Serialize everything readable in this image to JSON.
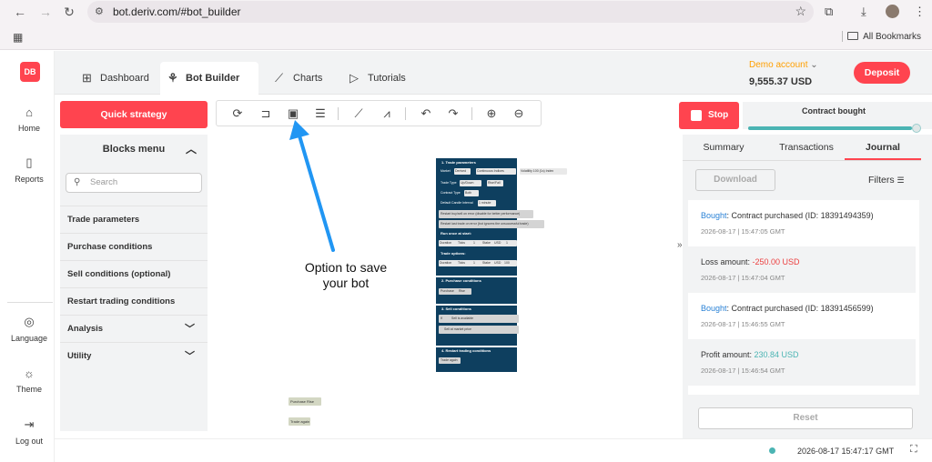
{
  "browser": {
    "url": "bot.deriv.com/#bot_builder",
    "bookmarks_label": "All Bookmarks"
  },
  "sidebar": {
    "logo": "DB",
    "items": [
      {
        "label": "Home",
        "icon": "home-icon"
      },
      {
        "label": "Reports",
        "icon": "report-icon"
      },
      {
        "label": "Language",
        "icon": "globe-icon"
      },
      {
        "label": "Theme",
        "icon": "sun-icon"
      },
      {
        "label": "Log out",
        "icon": "logout-icon"
      }
    ]
  },
  "header": {
    "tabs": [
      {
        "label": "Dashboard",
        "icon": "grid-icon"
      },
      {
        "label": "Bot Builder",
        "icon": "bot-icon",
        "active": true
      },
      {
        "label": "Charts",
        "icon": "chart-icon"
      },
      {
        "label": "Tutorials",
        "icon": "tutorial-icon"
      }
    ],
    "account_label": "Demo account",
    "balance": "9,555.37 USD",
    "deposit_label": "Deposit"
  },
  "builder": {
    "quick_strategy_label": "Quick strategy",
    "blocks_menu_title": "Blocks menu",
    "search_placeholder": "Search",
    "block_items": [
      {
        "label": "Trade parameters"
      },
      {
        "label": "Purchase conditions"
      },
      {
        "label": "Sell conditions (optional)"
      },
      {
        "label": "Restart trading conditions"
      },
      {
        "label": "Analysis",
        "expandable": true
      },
      {
        "label": "Utility",
        "expandable": true
      }
    ],
    "workspace": {
      "block_titles": [
        "1. Trade parameters",
        "2. Purchase conditions",
        "3. Sell conditions",
        "4. Restart trading conditions"
      ],
      "trade_params": {
        "market_label": "Market",
        "market_values": [
          "Derived",
          "Continuous Indices",
          "Volatility 100 (1s) Index"
        ],
        "trade_type_label": "Trade Type",
        "trade_type_values": [
          "Up/Down",
          "Rise/Fall"
        ],
        "contract_type_label": "Contract Type",
        "contract_type_value": "Both",
        "candle_label": "Default Candle Interval",
        "candle_value": "1 minute",
        "restart_error_label": "Restart buy/sell on error (disable for better performance)",
        "restart_last_label": "Restart last trade on error (bot ignores the unsuccessful trade)",
        "run_once_title": "Run once at start:",
        "run_once_row": [
          "Duration",
          "Ticks",
          "1",
          "Stake",
          "USD",
          "1"
        ],
        "trade_options_title": "Trade options:",
        "trade_options_row": [
          "Duration",
          "Ticks",
          "1",
          "Stake",
          "USD",
          "100"
        ]
      },
      "purchase_label": "Purchase",
      "purchase_value": "Rise",
      "sell_if_label": "if",
      "sell_available_label": "Sell is available",
      "sell_then_label": "Sell at market price",
      "restart_label": "Trade again",
      "loose_purchase_label": "Purchase",
      "loose_purchase_value": "Rise",
      "loose_trade_again": "Trade again"
    },
    "annotation": "Option to save your bot"
  },
  "run_panel": {
    "stop_label": "Stop",
    "status_label": "Contract bought",
    "progress": 1.0,
    "tabs": [
      "Summary",
      "Transactions",
      "Journal"
    ],
    "active_tab": "Journal",
    "download_label": "Download",
    "filters_label": "Filters",
    "journal": [
      {
        "prefix": "Bought",
        "text": ": Contract purchased (ID: 18391494359)",
        "time": "2026-08-17 | 15:47:05 GMT",
        "kind": "bought"
      },
      {
        "prefix": "Loss amount: ",
        "text": "-250.00 USD",
        "time": "2026-08-17 | 15:47:04 GMT",
        "kind": "loss"
      },
      {
        "prefix": "Bought",
        "text": ": Contract purchased (ID: 18391456599)",
        "time": "2026-08-17 | 15:46:55 GMT",
        "kind": "bought"
      },
      {
        "prefix": "Profit amount: ",
        "text": "230.84 USD",
        "time": "2026-08-17 | 15:46:54 GMT",
        "kind": "profit"
      }
    ],
    "reset_label": "Reset"
  },
  "footer": {
    "time": "2026-08-17 15:47:17 GMT"
  },
  "colors": {
    "brand": "#ff444f",
    "block": "#0e3f5f",
    "accent": "#2a82d6",
    "arrow": "#2196f3",
    "profit": "#4bb4b3",
    "loss": "#ec3f3f",
    "demo": "#ff9f00"
  }
}
